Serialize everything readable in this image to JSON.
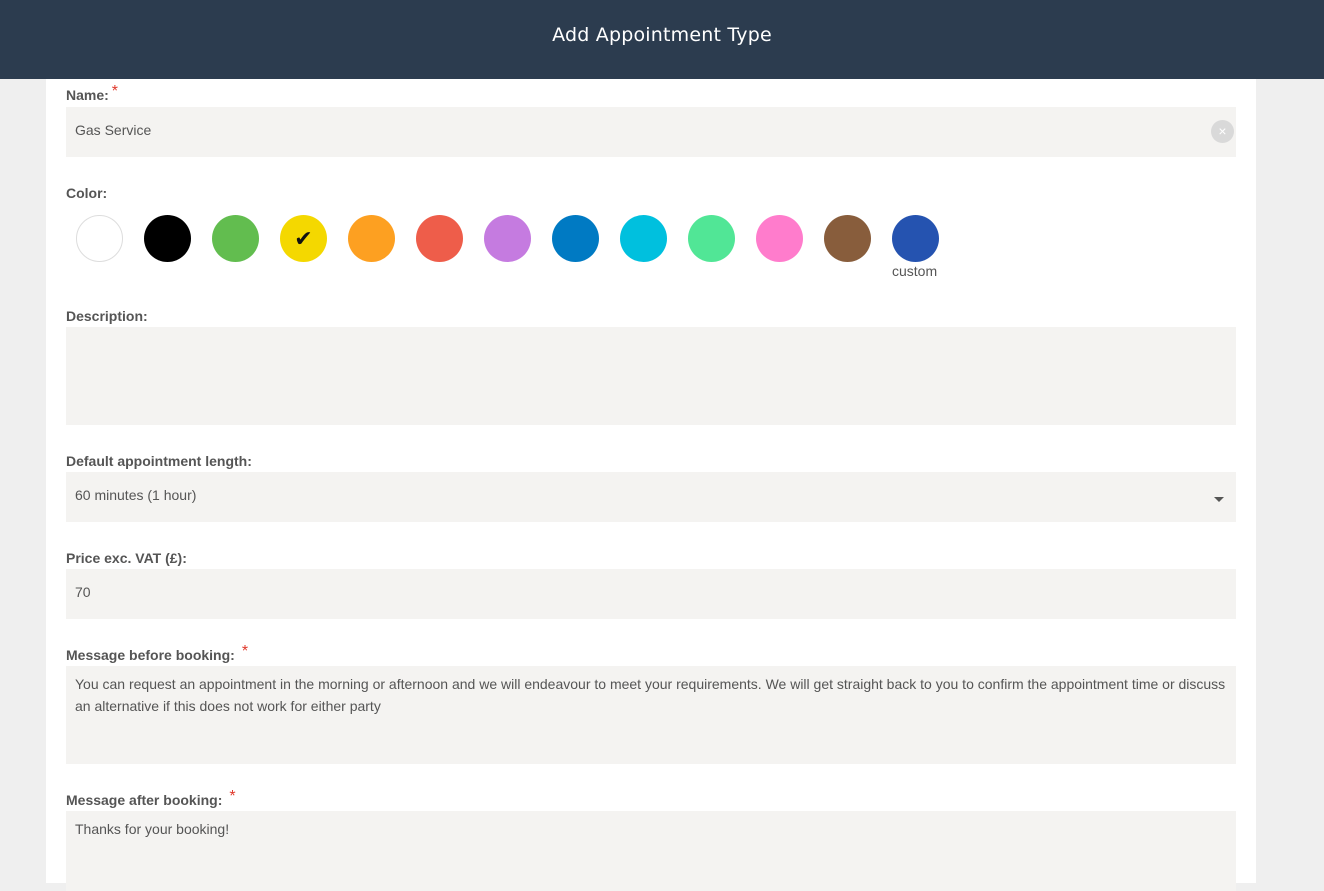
{
  "header": {
    "title": "Add Appointment Type"
  },
  "name": {
    "label": "Name:",
    "required_mark": "*",
    "value": "Gas Service",
    "clear_glyph": "×"
  },
  "color": {
    "label": "Color:",
    "swatches": [
      {
        "id": "white",
        "hex": "#ffffff",
        "selected": false
      },
      {
        "id": "black",
        "hex": "#000000",
        "selected": false
      },
      {
        "id": "green",
        "hex": "#62bd4f",
        "selected": false
      },
      {
        "id": "yellow",
        "hex": "#f4d800",
        "selected": true
      },
      {
        "id": "orange",
        "hex": "#fda021",
        "selected": false
      },
      {
        "id": "red",
        "hex": "#ee5d4a",
        "selected": false
      },
      {
        "id": "purple",
        "hex": "#c57be0",
        "selected": false
      },
      {
        "id": "blue",
        "hex": "#007ac3",
        "selected": false
      },
      {
        "id": "cyan",
        "hex": "#00c0de",
        "selected": false
      },
      {
        "id": "mint",
        "hex": "#51e696",
        "selected": false
      },
      {
        "id": "pink",
        "hex": "#ff7ccc",
        "selected": false
      },
      {
        "id": "brown",
        "hex": "#885d3c",
        "selected": false
      },
      {
        "id": "custom",
        "hex": "#2553b0",
        "selected": false
      }
    ],
    "check_glyph": "✔",
    "custom_label": "custom"
  },
  "description": {
    "label": "Description:",
    "value": ""
  },
  "length": {
    "label": "Default appointment length:",
    "value": "60 minutes (1 hour)"
  },
  "price": {
    "label": "Price exc. VAT (£):",
    "value": "70"
  },
  "message_before": {
    "label": "Message before booking:",
    "required_mark": "*",
    "value": "You can request an appointment in the morning or afternoon and we will endeavour to meet your requirements. We will get straight back to you to confirm the appointment time or discuss an alternative if this does not work for either party"
  },
  "message_after": {
    "label": "Message after booking:",
    "required_mark": "*",
    "value": "Thanks for your booking!"
  }
}
